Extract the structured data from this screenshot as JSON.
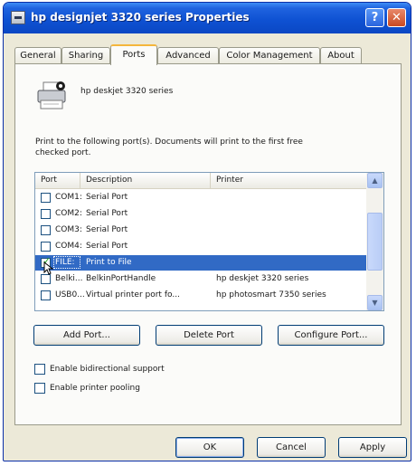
{
  "window": {
    "title": "hp designjet 3320 series Properties",
    "help_glyph": "?",
    "close_glyph": "✕"
  },
  "tabs": [
    {
      "label": "General",
      "active": false
    },
    {
      "label": "Sharing",
      "active": false
    },
    {
      "label": "Ports",
      "active": true
    },
    {
      "label": "Advanced",
      "active": false
    },
    {
      "label": "Color Management",
      "active": false
    },
    {
      "label": "About",
      "active": false
    }
  ],
  "ports_tab": {
    "printer_name": "hp deskjet 3320 series",
    "instruction": "Print to the following port(s). Documents will print to the first free checked port.",
    "columns": {
      "port": "Port",
      "description": "Description",
      "printer": "Printer"
    },
    "rows": [
      {
        "port": "COM1:",
        "description": "Serial Port",
        "printer": "",
        "checked": false,
        "selected": false
      },
      {
        "port": "COM2:",
        "description": "Serial Port",
        "printer": "",
        "checked": false,
        "selected": false
      },
      {
        "port": "COM3:",
        "description": "Serial Port",
        "printer": "",
        "checked": false,
        "selected": false
      },
      {
        "port": "COM4:",
        "description": "Serial Port",
        "printer": "",
        "checked": false,
        "selected": false
      },
      {
        "port": "FILE:",
        "description": "Print to File",
        "printer": "",
        "checked": true,
        "selected": true
      },
      {
        "port": "Belki...",
        "description": "BelkinPortHandle",
        "printer": "hp deskjet 3320 series",
        "checked": false,
        "selected": false
      },
      {
        "port": "USB0...",
        "description": "Virtual printer port fo...",
        "printer": "hp photosmart 7350 series",
        "checked": false,
        "selected": false
      }
    ],
    "add_port": "Add Port...",
    "delete_port": "Delete Port",
    "configure_port": "Configure Port...",
    "bidirectional": {
      "label": "Enable bidirectional support",
      "checked": false
    },
    "pooling": {
      "label": "Enable printer pooling",
      "checked": false
    }
  },
  "footer": {
    "ok": "OK",
    "cancel": "Cancel",
    "apply": "Apply"
  },
  "colors": {
    "title_bar": "#0f52d3",
    "selection": "#316ac5",
    "dialog_face": "#ece9d8",
    "active_tab_accent": "#f4b63c"
  }
}
